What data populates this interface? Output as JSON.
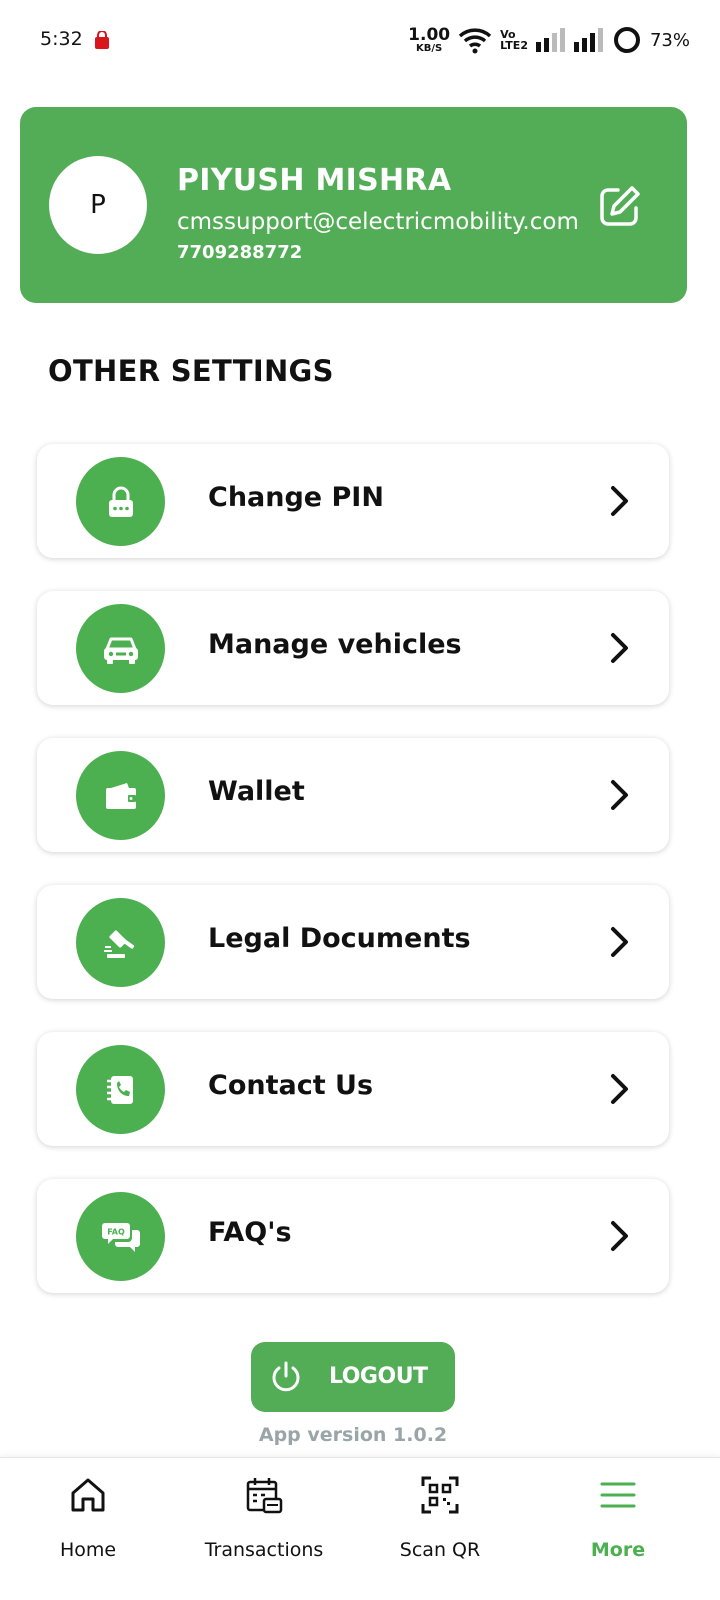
{
  "status_bar": {
    "time": "5:32",
    "net_speed_value": "1.00",
    "net_speed_unit": "KB/S",
    "volte_top": "Vo",
    "volte_bottom": "LTE2",
    "battery": "73%"
  },
  "profile": {
    "initial": "P",
    "name": "PIYUSH MISHRA",
    "email": "cmssupport@celectricmobility.com",
    "phone": "7709288772"
  },
  "section_title": "OTHER SETTINGS",
  "settings": [
    {
      "label": "Change PIN",
      "icon": "lock-icon"
    },
    {
      "label": "Manage vehicles",
      "icon": "car-icon"
    },
    {
      "label": "Wallet",
      "icon": "wallet-icon"
    },
    {
      "label": "Legal Documents",
      "icon": "gavel-icon"
    },
    {
      "label": "Contact Us",
      "icon": "contact-book-icon"
    },
    {
      "label": "FAQ's",
      "icon": "faq-icon",
      "icon_text": "FAQ"
    }
  ],
  "logout_label": "LOGOUT",
  "app_version": "App version 1.0.2",
  "nav": [
    {
      "label": "Home",
      "icon": "home-icon"
    },
    {
      "label": "Transactions",
      "icon": "transactions-icon"
    },
    {
      "label": "Scan QR",
      "icon": "qr-scan-icon"
    },
    {
      "label": "More",
      "icon": "menu-icon",
      "active": true
    }
  ],
  "colors": {
    "primary_green": "#53ad57",
    "icon_green": "#4caf50",
    "muted_text": "#9aa5a8"
  }
}
